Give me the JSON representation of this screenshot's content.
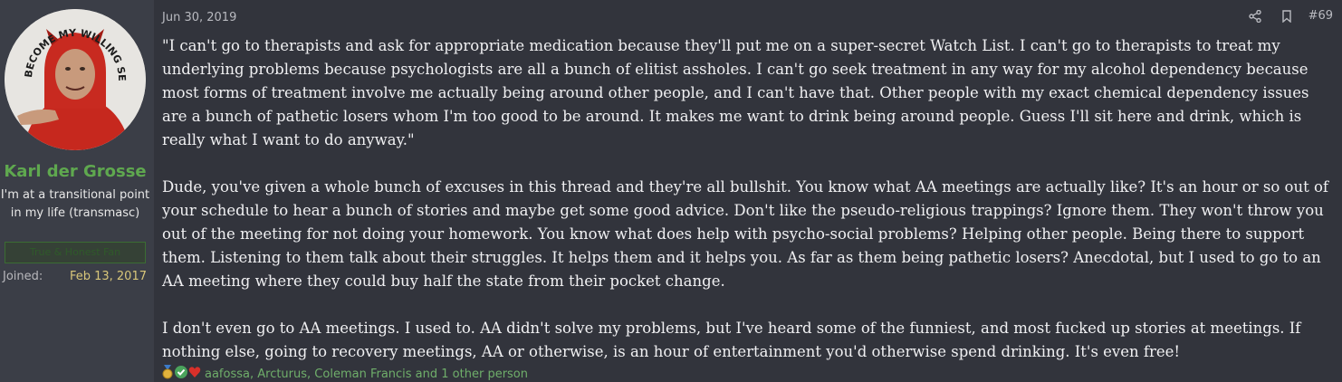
{
  "user": {
    "avatar_icon": "devil-costume-avatar",
    "avatar_caption": "BECOME MY WILLING SERVANT!",
    "name": "Karl der Grosse",
    "title": "I'm at a transitional point in my life (transmasc)",
    "banner": "True & Honest Fan",
    "joined_label": "Joined:",
    "joined_value": "Feb 13, 2017"
  },
  "post": {
    "date": "Jun 30, 2019",
    "number": "#69",
    "share_icon": "share-icon",
    "bookmark_icon": "bookmark-icon",
    "paragraphs": [
      "\"I can't go to therapists and ask for appropriate medication because they'll put me on a super-secret Watch List. I can't go to therapists to treat my underlying problems because psychologists are all a bunch of elitist assholes. I can't go seek treatment in any way for my alcohol dependency because most forms of treatment involve me actually being around other people, and I can't have that. Other people with my exact chemical dependency issues are a bunch of pathetic losers whom I'm too good to be around. It makes me want to drink being around people. Guess I'll sit here and drink, which is really what I want to do anyway.\"",
      "Dude, you've given a whole bunch of excuses in this thread and they're all bullshit. You know what AA meetings are actually like? It's an hour or so out of your schedule to hear a bunch of stories and maybe get some good advice. Don't like the pseudo-religious trappings? Ignore them. They won't throw you out of the meeting for not doing your homework. You know what does help with psycho-social problems? Helping other people. Being there to support them. Listening to them talk about their struggles. It helps them and it helps you. As far as them being pathetic losers? Anecdotal, but I used to go to an AA meeting where they could buy half the state from their pocket change.",
      "I don't even go to AA meetings. I used to. AA didn't solve my problems, but I've heard some of the funniest, and most fucked up stories at meetings. If nothing else, going to recovery meetings, AA or otherwise, is an hour of entertainment you'd otherwise spend drinking. It's even free!"
    ]
  },
  "reactions": {
    "icons": [
      "medal-icon",
      "check-icon",
      "heart-icon"
    ],
    "text": "aafossa, Arcturus, Coleman Francis and 1 other person"
  }
}
